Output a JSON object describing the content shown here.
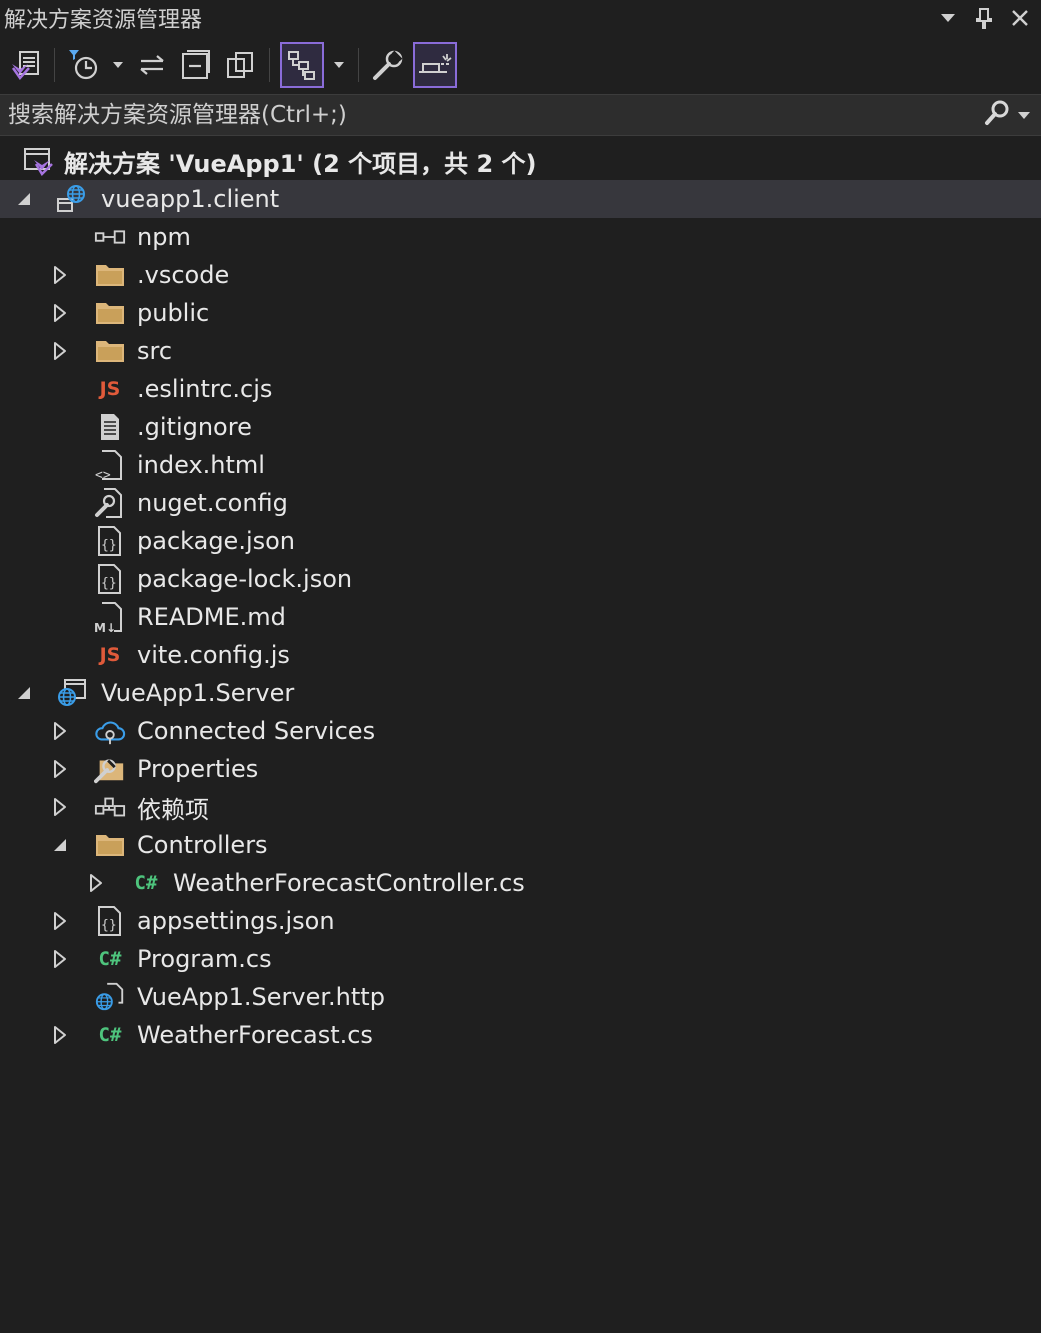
{
  "window": {
    "title": "解决方案资源管理器",
    "actions": [
      "dropdown-icon",
      "pin-icon",
      "close-icon"
    ]
  },
  "toolbar": {
    "buttons": [
      {
        "name": "switch-views-icon"
      },
      {
        "name": "pending-changes-filter-icon",
        "dropdown": true
      },
      {
        "name": "sync-with-active-document-icon"
      },
      {
        "name": "collapse-all-icon"
      },
      {
        "name": "show-all-files-icon"
      },
      {
        "name": "show-tree-view-icon",
        "active": true,
        "dropdown": true
      },
      {
        "name": "properties-icon"
      },
      {
        "name": "preview-selected-items-icon",
        "active": true
      }
    ]
  },
  "search": {
    "placeholder": "搜索解决方案资源管理器(Ctrl+;)"
  },
  "tree": {
    "solution": "解决方案 'VueApp1' (2 个项目，共 2 个)",
    "items": [
      {
        "label": "vueapp1.client",
        "icon": "web-project-icon",
        "arrow": "expanded",
        "level": 0,
        "selected": true
      },
      {
        "label": "npm",
        "icon": "npm-icon",
        "arrow": "none",
        "level": 1
      },
      {
        "label": ".vscode",
        "icon": "folder-icon",
        "arrow": "collapsed",
        "level": 1
      },
      {
        "label": "public",
        "icon": "folder-icon",
        "arrow": "collapsed",
        "level": 1
      },
      {
        "label": "src",
        "icon": "folder-icon",
        "arrow": "collapsed",
        "level": 1
      },
      {
        "label": ".eslintrc.cjs",
        "icon": "js-file-icon",
        "arrow": "none",
        "level": 1
      },
      {
        "label": ".gitignore",
        "icon": "text-file-icon",
        "arrow": "none",
        "level": 1
      },
      {
        "label": "index.html",
        "icon": "html-file-icon",
        "arrow": "none",
        "level": 1
      },
      {
        "label": "nuget.config",
        "icon": "config-file-icon",
        "arrow": "none",
        "level": 1
      },
      {
        "label": "package.json",
        "icon": "json-file-icon",
        "arrow": "none",
        "level": 1
      },
      {
        "label": "package-lock.json",
        "icon": "json-file-icon",
        "arrow": "none",
        "level": 1
      },
      {
        "label": "README.md",
        "icon": "markdown-file-icon",
        "arrow": "none",
        "level": 1
      },
      {
        "label": "vite.config.js",
        "icon": "js-file-icon",
        "arrow": "none",
        "level": 1
      },
      {
        "label": "VueApp1.Server",
        "icon": "web-app-icon",
        "arrow": "expanded",
        "level": 0
      },
      {
        "label": "Connected Services",
        "icon": "connected-services-icon",
        "arrow": "collapsed",
        "level": 1
      },
      {
        "label": "Properties",
        "icon": "properties-folder-icon",
        "arrow": "collapsed",
        "level": 1
      },
      {
        "label": "依赖项",
        "icon": "dependencies-icon",
        "arrow": "collapsed",
        "level": 1
      },
      {
        "label": "Controllers",
        "icon": "folder-icon",
        "arrow": "expanded",
        "level": 1
      },
      {
        "label": "WeatherForecastController.cs",
        "icon": "csharp-file-icon",
        "arrow": "collapsed",
        "level": 2
      },
      {
        "label": "appsettings.json",
        "icon": "json-file-icon",
        "arrow": "collapsed",
        "level": 1
      },
      {
        "label": "Program.cs",
        "icon": "csharp-file-icon",
        "arrow": "collapsed",
        "level": 1
      },
      {
        "label": "VueApp1.Server.http",
        "icon": "http-file-icon",
        "arrow": "none",
        "level": 1
      },
      {
        "label": "WeatherForecast.cs",
        "icon": "csharp-file-icon",
        "arrow": "collapsed",
        "level": 1
      }
    ]
  },
  "colors": {
    "background": "#1f1f1f",
    "selected_row": "#37373d",
    "accent": "#8a6cd9",
    "folder": "#dcb67a",
    "csharp": "#4ec47d",
    "javascript": "#e05a3a",
    "web_blue": "#3a9de8"
  }
}
